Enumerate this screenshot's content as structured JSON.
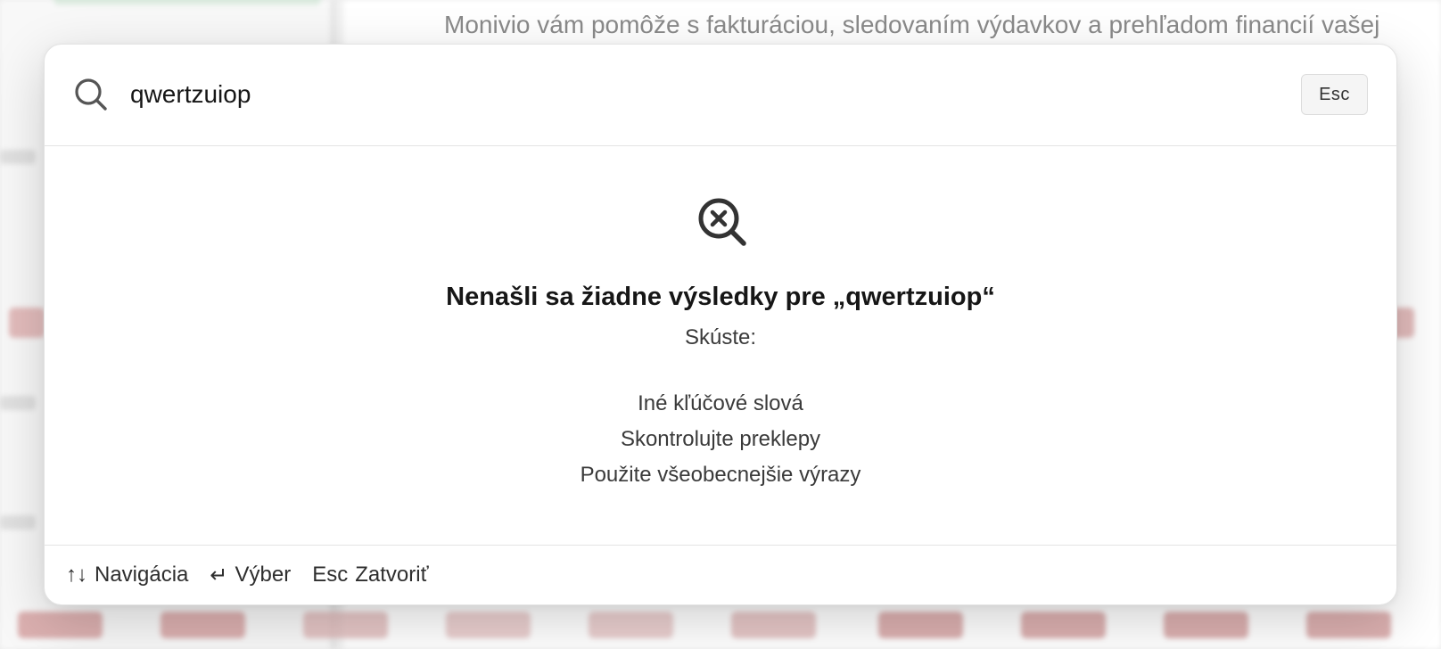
{
  "background": {
    "intro_text": "Monivio vám pomôže s fakturáciou, sledovaním výdavkov a prehľadom financií vašej"
  },
  "palette": {
    "search": {
      "value": "qwertzuiop",
      "icon": "search-icon"
    },
    "close_key_label": "Esc",
    "empty_state": {
      "icon": "search-x-icon",
      "title": "Nenašli sa žiadne výsledky pre „qwertzuiop“",
      "subtitle": "Skúste:",
      "tips": [
        "Iné kľúčové slová",
        "Skontrolujte preklepy",
        "Použite všeobecnejšie výrazy"
      ]
    },
    "footer": {
      "navigate": {
        "key": "↑↓",
        "label": "Navigácia"
      },
      "select": {
        "key": "↵",
        "label": "Výber"
      },
      "close": {
        "key": "Esc",
        "label": "Zatvoriť"
      }
    }
  },
  "colors": {
    "accent_red_bg": "#c98686",
    "text_primary": "#161616",
    "text_secondary": "#3a3a3a"
  }
}
